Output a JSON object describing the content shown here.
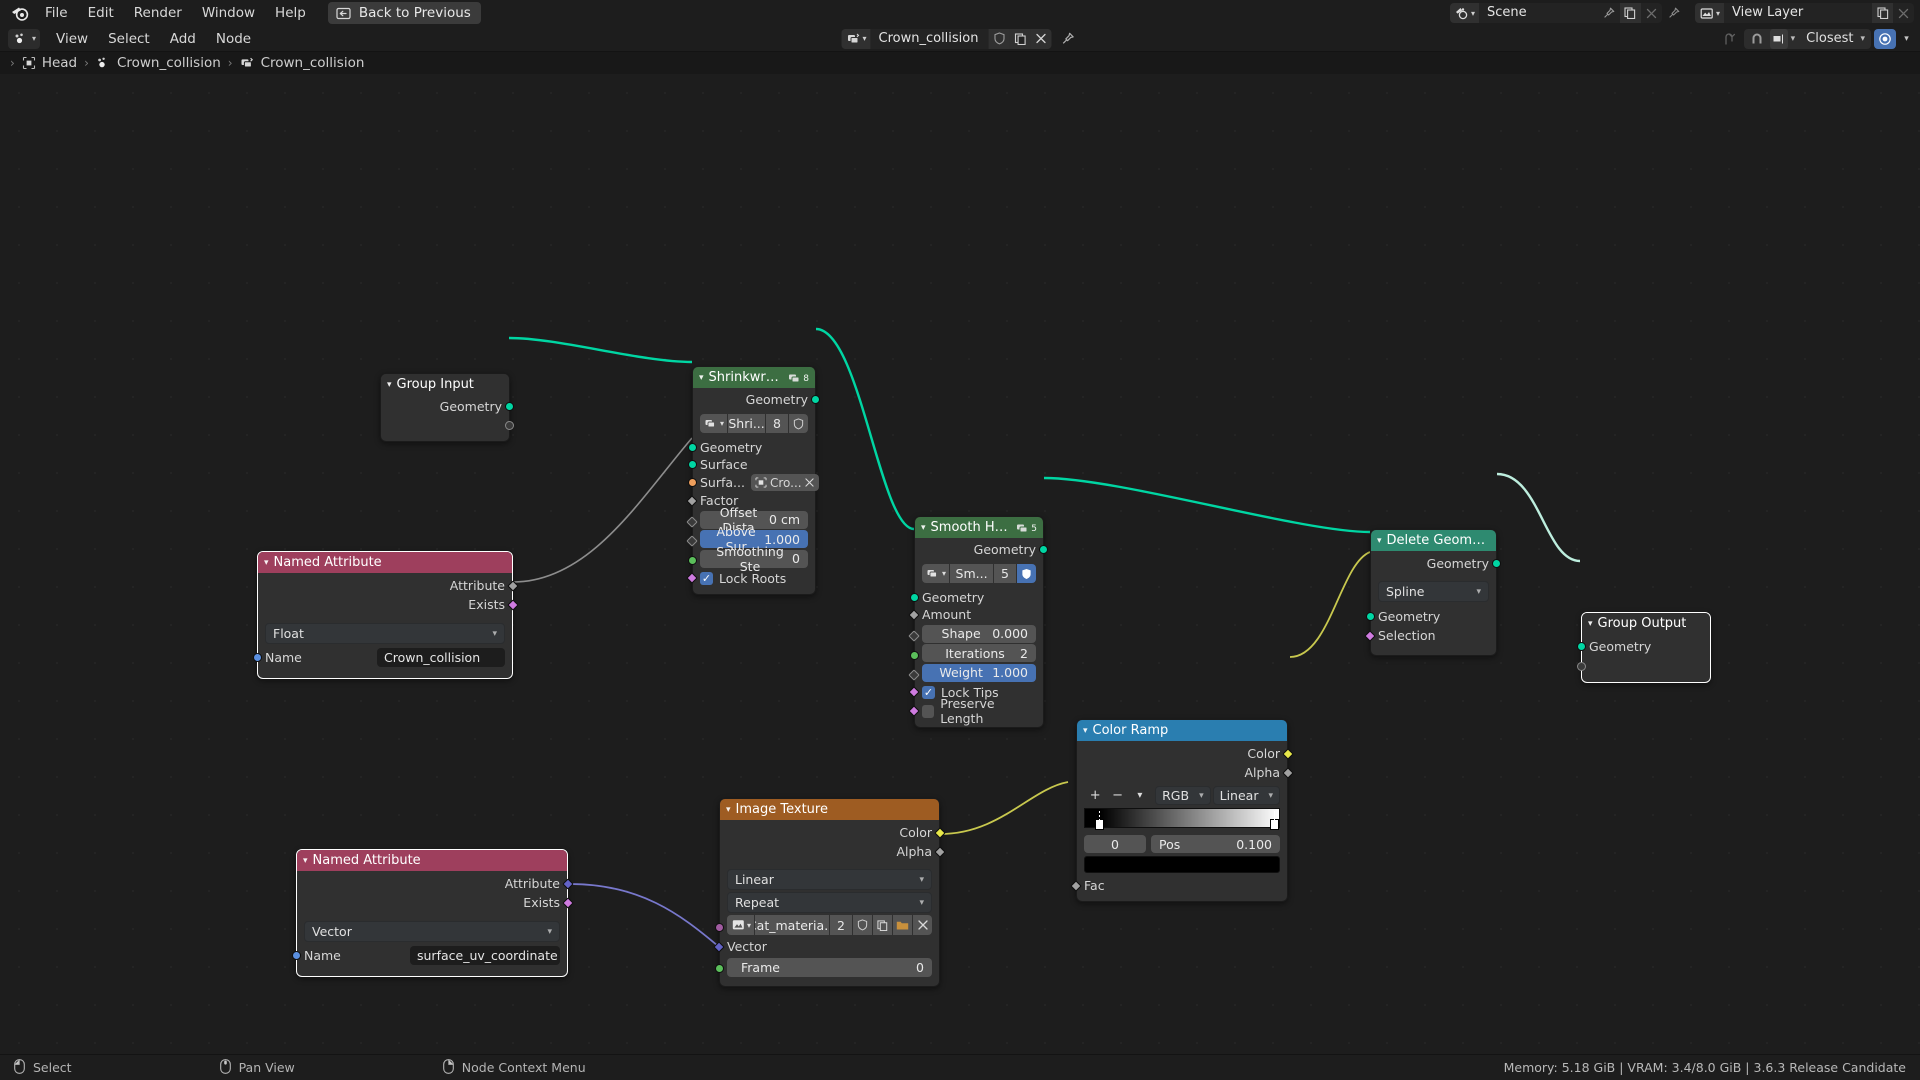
{
  "topbar": {
    "logo_icon": "blender-logo-icon",
    "menus": [
      "File",
      "Edit",
      "Render",
      "Window",
      "Help"
    ],
    "back_button": {
      "label": "Back to Previous",
      "icon": "back-to-previous-icon"
    },
    "scene_field": {
      "icon": "scene-icon",
      "value": "Scene",
      "pin_icon": "pin-icon",
      "copy_icon": "new-scene-icon",
      "close_icon": "unlink-scene-icon"
    },
    "viewlayer_field": {
      "icon": "view-layer-icon",
      "value": "View Layer",
      "copy_icon": "new-view-layer-icon",
      "close_icon": "remove-view-layer-icon"
    }
  },
  "editor_header": {
    "editor_type_icon": "geometry-node-editor-icon",
    "menus": [
      "View",
      "Select",
      "Add",
      "Node"
    ],
    "nodetree_field": {
      "browse_icon": "browse-node-tree-icon",
      "value": "Crown_collision",
      "fake_user_icon": "shield-icon",
      "copy_icon": "duplicate-icon",
      "close_icon": "unlink-icon",
      "pin_icon": "pin-icon"
    },
    "right_tools": {
      "parent_icon": "go-to-parent-icon",
      "snap_icon": "snap-magnet-icon",
      "snap_element_icon": "snap-element-icon",
      "snap_target": "Closest",
      "proportional_icon": "proportional-editing-icon"
    }
  },
  "breadcrumb": {
    "items": [
      {
        "icon": "object-icon",
        "label": "Head"
      },
      {
        "icon": "modifier-nodes-icon",
        "label": "Crown_collision"
      },
      {
        "icon": "node-tree-icon",
        "label": "Crown_collision"
      }
    ],
    "separator": "›"
  },
  "nodes": {
    "group_input": {
      "title": "Group Input",
      "header_color": "#303030",
      "outputs": [
        {
          "label": "Geometry",
          "socket": "geometry",
          "color": "#00d6a3"
        }
      ],
      "virtual_socket": ""
    },
    "shrinkwrap_hair": {
      "title": "Shrinkwrap Hair",
      "header_color": "#3c6e42",
      "badge_count": "8",
      "outputs": [
        {
          "label": "Geometry",
          "color": "#00d6a3"
        }
      ],
      "group_asset": {
        "browse_icon": "browse-group-icon",
        "name": "Shri...",
        "users": "8",
        "fake_user_icon": "shield-icon"
      },
      "inputs": [
        {
          "label": "Geometry",
          "color": "#00d6a3"
        },
        {
          "label": "Surface",
          "color": "#00d6a3"
        }
      ],
      "object_field": {
        "label": "Surfa...",
        "icon": "object-data-icon",
        "value": "Cro...",
        "clear_icon": "x-icon",
        "color": "#ed9e5c"
      },
      "factor_label": "Factor",
      "fields": [
        {
          "label": "Offset Dista",
          "value": "0 cm",
          "highlight": false,
          "socket": "diamond-gray"
        },
        {
          "label": "Above Sur",
          "value": "1.000",
          "highlight": true,
          "socket": "diamond-gray"
        },
        {
          "label": "Smoothing Ste",
          "value": "0",
          "highlight": false,
          "socket": "dot-green"
        }
      ],
      "checkbox": {
        "label": "Lock Roots",
        "checked": true,
        "socket": "diamond-purple"
      }
    },
    "smooth_hair_curves": {
      "title": "Smooth Hair Cur...",
      "header_color": "#3c6e42",
      "badge_count": "5",
      "outputs": [
        {
          "label": "Geometry",
          "color": "#00d6a3"
        }
      ],
      "group_asset": {
        "browse_icon": "browse-group-icon",
        "name": "Sm...",
        "users": "5",
        "fake_user_icon": "shield-icon",
        "fake_user_on": true
      },
      "inputs": [
        {
          "label": "Geometry",
          "color": "#00d6a3"
        },
        {
          "label": "Amount",
          "color": "#a1a1a1"
        }
      ],
      "fields": [
        {
          "label": "Shape",
          "value": "0.000",
          "highlight": false
        },
        {
          "label": "Iterations",
          "value": "2",
          "highlight": false
        },
        {
          "label": "Weight",
          "value": "1.000",
          "highlight": true
        }
      ],
      "checkboxes": [
        {
          "label": "Lock Tips",
          "checked": true
        },
        {
          "label": "Preserve Length",
          "checked": false
        }
      ]
    },
    "named_attribute_float": {
      "title": "Named Attribute",
      "header_color": "#9e3f5d",
      "outputs": [
        {
          "label": "Attribute",
          "color": "#a1a1a1"
        },
        {
          "label": "Exists",
          "color": "#cf7be0"
        }
      ],
      "data_type": "Float",
      "name_label": "Name",
      "name_value": "Crown_collision"
    },
    "named_attribute_vector": {
      "title": "Named Attribute",
      "header_color": "#9e3f5d",
      "outputs": [
        {
          "label": "Attribute",
          "color": "#6363c7"
        },
        {
          "label": "Exists",
          "color": "#cf7be0"
        }
      ],
      "data_type": "Vector",
      "name_label": "Name",
      "name_value": "surface_uv_coordinate"
    },
    "image_texture": {
      "title": "Image Texture",
      "header_color": "#9e5c22",
      "outputs": [
        {
          "label": "Color",
          "color": "#e8e84a"
        },
        {
          "label": "Alpha",
          "color": "#a1a1a1"
        }
      ],
      "interpolation": "Linear",
      "extension": "Repeat",
      "image_block": {
        "browse_icon": "browse-image-icon",
        "name": "Cat_materia...",
        "users": "2",
        "fake_user_icon": "shield-icon",
        "copy_icon": "duplicate-icon",
        "open_icon": "folder-icon",
        "close_icon": "x-icon"
      },
      "vector_label": "Vector",
      "frame": {
        "label": "Frame",
        "value": "0"
      }
    },
    "color_ramp": {
      "title": "Color Ramp",
      "header_color": "#2a7eb0",
      "outputs": [
        {
          "label": "Color",
          "color": "#e8e84a"
        },
        {
          "label": "Alpha",
          "color": "#a1a1a1"
        }
      ],
      "tools": {
        "add_icon": "plus-icon",
        "remove_icon": "minus-icon",
        "menu_icon": "chevron-down-icon",
        "color_mode": "RGB",
        "interpolation": "Linear"
      },
      "gradient": {
        "stop_left_pos": 0.04,
        "stop_right_pos": 0.985,
        "left_color": "#000000",
        "right_color": "#ffffff"
      },
      "index_value": "0",
      "pos_label": "Pos",
      "pos_value": "0.100",
      "swatch_color": "#000000",
      "input_label": "Fac"
    },
    "delete_geometry": {
      "title": "Delete Geometry",
      "header_color": "#2e8a70",
      "outputs": [
        {
          "label": "Geometry",
          "color": "#00d6a3"
        }
      ],
      "domain": "Spline",
      "inputs": [
        {
          "label": "Geometry",
          "color": "#00d6a3"
        },
        {
          "label": "Selection",
          "color": "#cf7be0"
        }
      ]
    },
    "group_output": {
      "title": "Group Output",
      "header_color": "#303030",
      "inputs": [
        {
          "label": "Geometry",
          "color": "#00d6a3"
        }
      ],
      "virtual_socket": ""
    }
  },
  "statusbar": {
    "items": [
      {
        "icon": "mouse-left-icon",
        "label": "Select"
      },
      {
        "icon": "mouse-middle-icon",
        "label": "Pan View"
      },
      {
        "icon": "mouse-right-icon",
        "label": "Node Context Menu"
      }
    ],
    "info": "Memory: 5.18 GiB | VRAM: 3.4/8.0 GiB | 3.6.3 Release Candidate"
  }
}
